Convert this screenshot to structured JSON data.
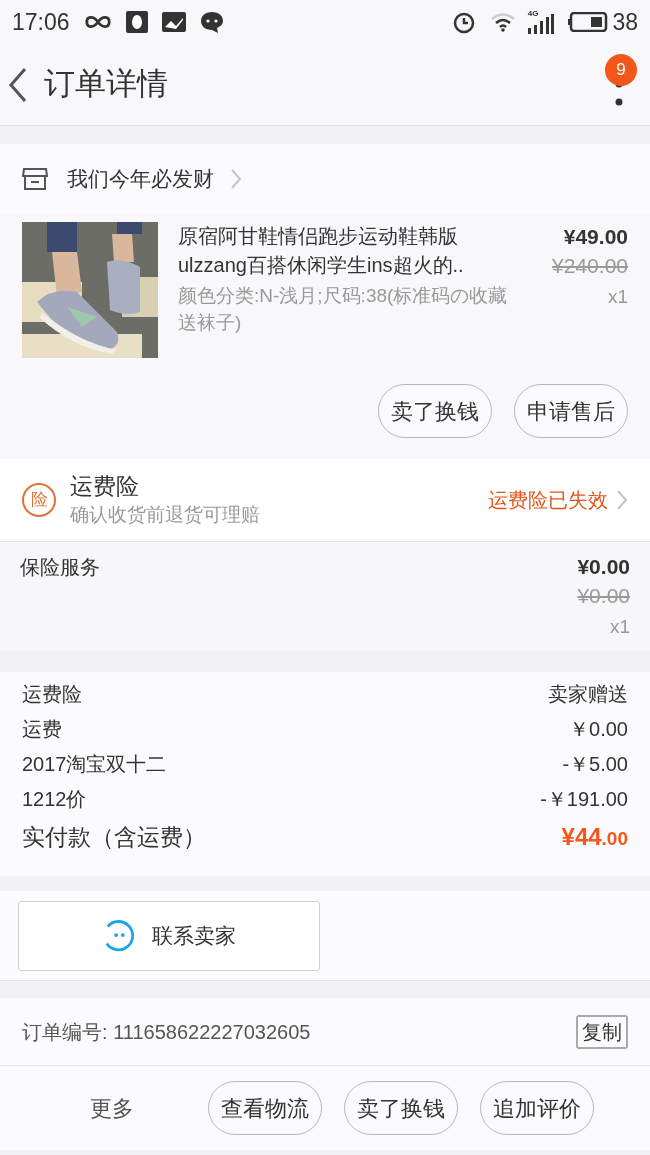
{
  "status_bar": {
    "time": "17:06",
    "network": "4G",
    "battery": "38"
  },
  "header": {
    "title": "订单详情",
    "badge": "9"
  },
  "shop": {
    "name": "我们今年必发财"
  },
  "product": {
    "title": "原宿阿甘鞋情侣跑步运动鞋韩版ulzzang百搭休闲学生ins超火的..",
    "sku": "颜色分类:N-浅月;尺码:38(标准码の收藏送袜子)",
    "price": "¥49.00",
    "original_price": "¥240.00",
    "quantity": "x1",
    "buttons": [
      "卖了换钱",
      "申请售后"
    ]
  },
  "freight_insurance": {
    "icon_char": "险",
    "title": "运费险",
    "subtitle": "确认收货前退货可理赔",
    "status": "运费险已失效"
  },
  "insurance_service": {
    "label": "保险服务",
    "price": "¥0.00",
    "original_price": "¥0.00",
    "quantity": "x1"
  },
  "summary": {
    "rows": [
      {
        "label": "运费险",
        "value": "卖家赠送"
      },
      {
        "label": "运费",
        "value": "￥0.00"
      },
      {
        "label": "2017淘宝双十二",
        "value": "-￥5.00"
      },
      {
        "label": "1212价",
        "value": "-￥191.00"
      }
    ],
    "total": {
      "label": "实付款（含运费）",
      "value_main": "¥44",
      "value_decimal": ".00"
    }
  },
  "contact_button": "联系卖家",
  "order": {
    "number_label": "订单编号:",
    "number": "111658622227032605",
    "copy": "复制"
  },
  "bottom_bar": {
    "more": "更多",
    "buttons": [
      "查看物流",
      "卖了换钱",
      "追加评价"
    ]
  }
}
